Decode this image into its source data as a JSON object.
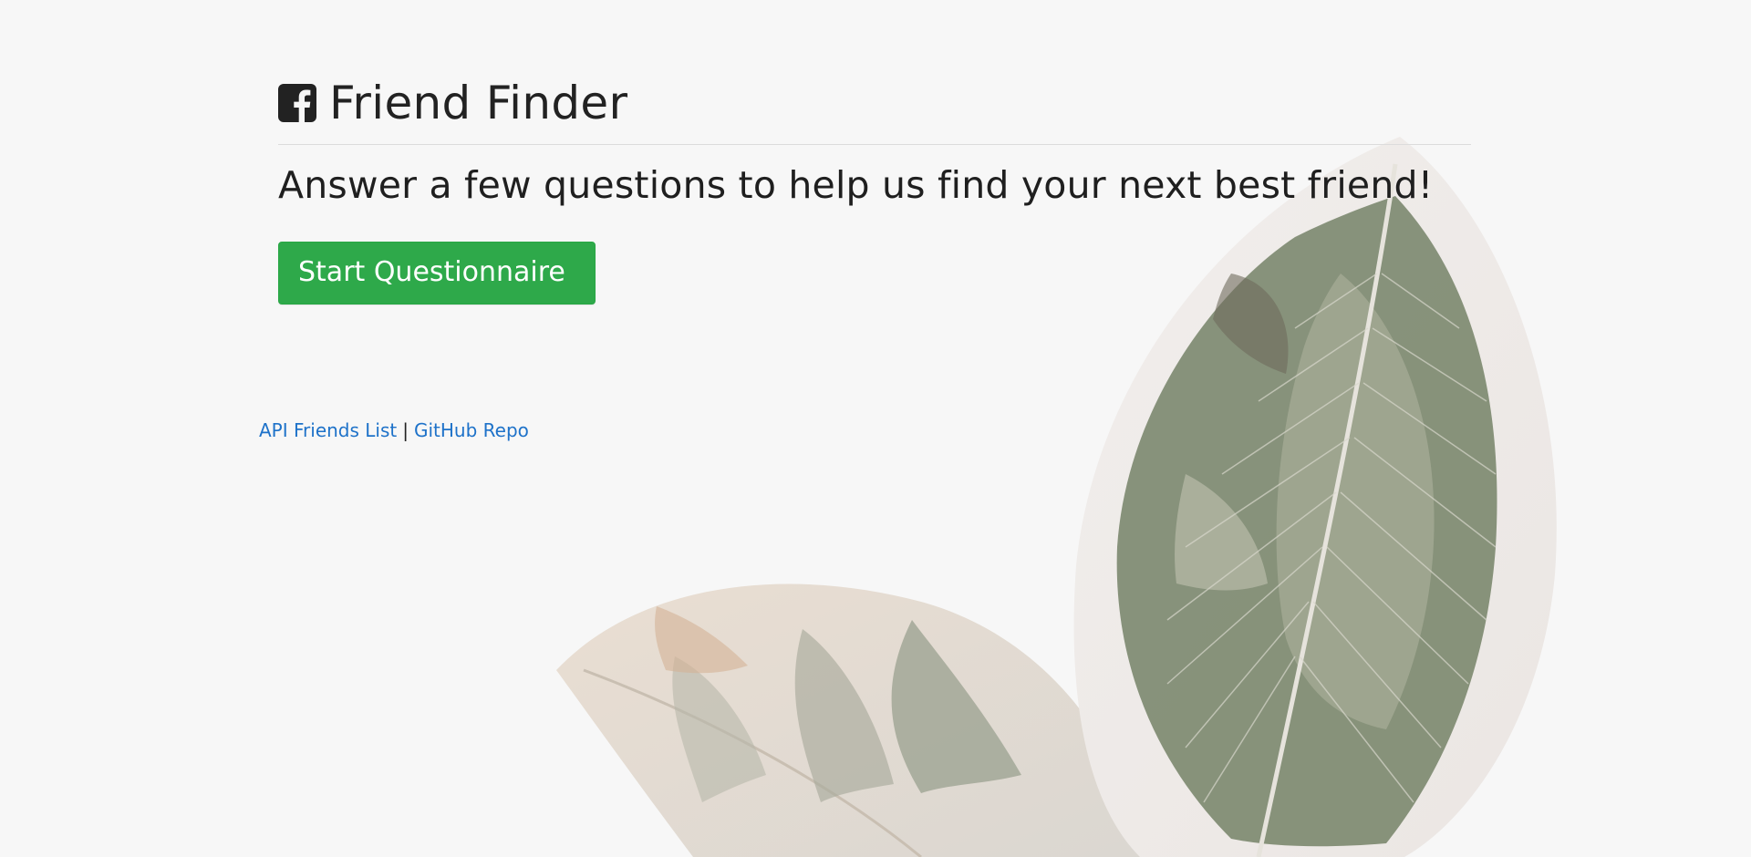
{
  "header": {
    "title": "Friend Finder",
    "icon": "facebook-square-icon"
  },
  "main": {
    "lead": "Answer a few questions to help us find your next best friend!",
    "start_button_label": "Start Questionnaire"
  },
  "footer": {
    "links": [
      {
        "label": "API Friends List"
      },
      {
        "label": "GitHub Repo"
      }
    ],
    "separator": "|"
  },
  "colors": {
    "background": "#f7f7f7",
    "button": "#2ea94a",
    "link": "#1e72c9",
    "text": "#222222"
  }
}
